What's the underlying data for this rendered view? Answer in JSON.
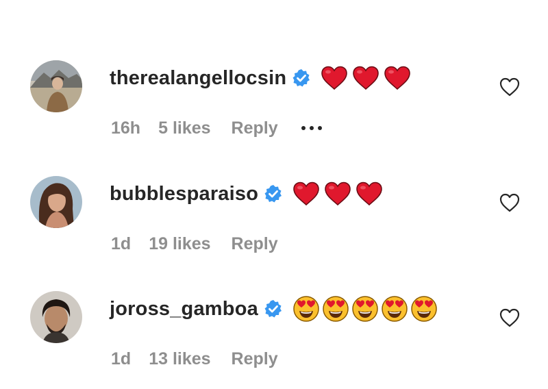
{
  "comments": [
    {
      "username": "therealangellocsin",
      "verified": true,
      "emoji": "red-heart",
      "emoji_count": 3,
      "time": "16h",
      "likes": "5 likes",
      "reply_label": "Reply",
      "has_more_menu": true,
      "avatar": {
        "bg": "#b9b2a4",
        "figure": "#7a6a58"
      }
    },
    {
      "username": "bubblesparaiso",
      "verified": true,
      "emoji": "red-heart",
      "emoji_count": 3,
      "time": "1d",
      "likes": "19 likes",
      "reply_label": "Reply",
      "has_more_menu": false,
      "avatar": {
        "bg": "#a9b9c8",
        "figure": "#5a3a2a"
      }
    },
    {
      "username": "joross_gamboa",
      "verified": true,
      "emoji": "heart-eyes-face",
      "emoji_count": 5,
      "time": "1d",
      "likes": "13 likes",
      "reply_label": "Reply",
      "has_more_menu": false,
      "avatar": {
        "bg": "#cbc6c0",
        "figure": "#2a1f1a"
      }
    }
  ],
  "colors": {
    "username": "#262626",
    "meta": "#8e8e8e",
    "verified": "#3897f0",
    "heart_red": "#e0182d"
  }
}
